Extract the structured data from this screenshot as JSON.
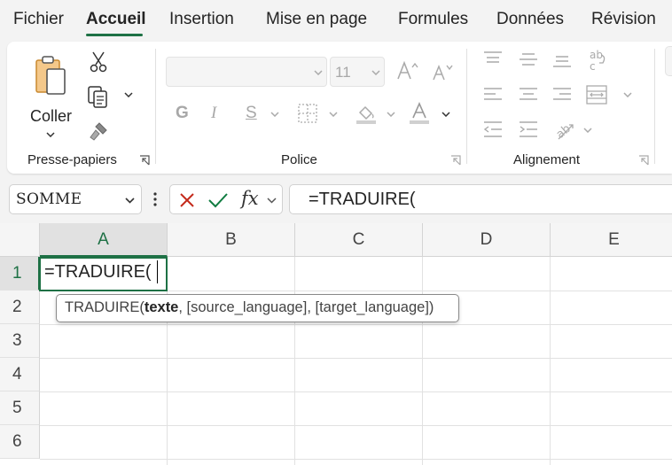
{
  "tabs": {
    "file": "Fichier",
    "home": "Accueil",
    "insert": "Insertion",
    "layout": "Mise en page",
    "formulas": "Formules",
    "data": "Données",
    "review": "Révision"
  },
  "ribbon": {
    "clipboard": {
      "paste_label": "Coller",
      "group_label": "Presse-papiers"
    },
    "font": {
      "font_size": "11",
      "bold": "G",
      "italic": "I",
      "underline": "S",
      "group_label": "Police"
    },
    "alignment": {
      "group_label": "Alignement"
    }
  },
  "formula_bar": {
    "name_box": "SOMME",
    "fx_label": "fx",
    "formula": "=TRADUIRE("
  },
  "grid": {
    "columns": [
      "A",
      "B",
      "C",
      "D",
      "E"
    ],
    "rows": [
      "1",
      "2",
      "3",
      "4",
      "5",
      "6"
    ],
    "active_cell_value": "=TRADUIRE(",
    "tooltip": {
      "function": "TRADUIRE(",
      "arg_current": "texte",
      "rest": ", [source_language], [target_language])"
    }
  },
  "colors": {
    "accent": "#1e7145",
    "cancel": "#c42b1c",
    "enter": "#107c41"
  },
  "icons": [
    "paste-icon",
    "cut-icon",
    "copy-icon",
    "format-painter-icon",
    "grow-font-icon",
    "shrink-font-icon",
    "borders-icon",
    "fill-color-icon",
    "font-color-icon",
    "align-top-icon",
    "align-middle-icon",
    "align-bottom-icon",
    "wrap-text-icon",
    "align-left-icon",
    "align-center-icon",
    "align-right-icon",
    "merge-icon",
    "decrease-indent-icon",
    "increase-indent-icon",
    "orientation-icon",
    "dialog-launcher-icon",
    "cancel-icon",
    "enter-icon",
    "chevron-down-icon"
  ]
}
